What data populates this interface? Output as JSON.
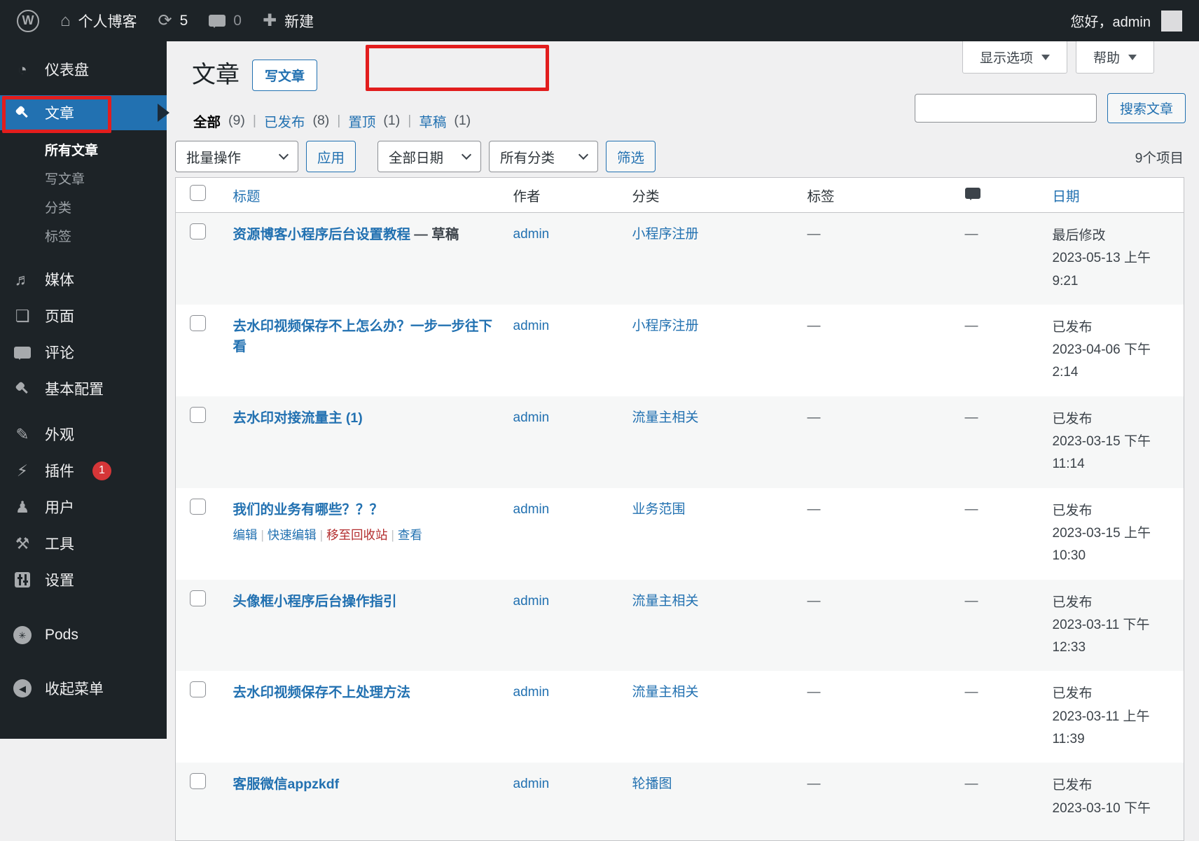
{
  "accent_colors": {
    "link_blue": "#2271b1",
    "sidebar_dark": "#1d2327",
    "annotation_red": "#e21d1d",
    "badge_red": "#d63638"
  },
  "admin_bar": {
    "site_name": "个人博客",
    "updates_count": "5",
    "comments_count": "0",
    "new_label": "新建",
    "greeting": "您好，admin"
  },
  "sidebar": {
    "items": [
      {
        "label": "仪表盘"
      },
      {
        "label": "文章"
      },
      {
        "label": "媒体"
      },
      {
        "label": "页面"
      },
      {
        "label": "评论"
      },
      {
        "label": "基本配置"
      },
      {
        "label": "外观"
      },
      {
        "label": "插件"
      },
      {
        "label": "用户"
      },
      {
        "label": "工具"
      },
      {
        "label": "设置"
      },
      {
        "label": "Pods"
      },
      {
        "label": "收起菜单"
      }
    ],
    "plugins_badge": "1",
    "submenu": [
      {
        "label": "所有文章"
      },
      {
        "label": "写文章"
      },
      {
        "label": "分类"
      },
      {
        "label": "标签"
      }
    ]
  },
  "page": {
    "title": "文章",
    "add_new_label": "写文章",
    "screen_options_label": "显示选项",
    "help_label": "帮助",
    "search_button_label": "搜索文章",
    "items_count": "9个项目",
    "filters": [
      {
        "label": "全部",
        "count": "(9)"
      },
      {
        "label": "已发布",
        "count": "(8)"
      },
      {
        "label": "置顶",
        "count": "(1)"
      },
      {
        "label": "草稿",
        "count": "(1)"
      }
    ],
    "bulk": {
      "bulk_action": "批量操作",
      "apply": "应用",
      "all_dates": "全部日期",
      "all_categories": "所有分类",
      "filter": "筛选"
    }
  },
  "table": {
    "headers": {
      "title": "标题",
      "author": "作者",
      "category": "分类",
      "tags": "标签",
      "date": "日期"
    },
    "row_actions": {
      "edit": "编辑",
      "quick_edit": "快速编辑",
      "trash": "移至回收站",
      "view": "查看"
    },
    "rows": [
      {
        "title": "资源博客小程序后台设置教程",
        "state": "— 草稿",
        "author": "admin",
        "category": "小程序注册",
        "tags": "—",
        "comments": "—",
        "status": "最后修改",
        "datetime": "2023-05-13 上午 9:21"
      },
      {
        "title": "去水印视频保存不上怎么办？一步一步往下看",
        "author": "admin",
        "category": "小程序注册",
        "tags": "—",
        "comments": "—",
        "status": "已发布",
        "datetime": "2023-04-06 下午 2:14"
      },
      {
        "title": "去水印对接流量主 (1)",
        "author": "admin",
        "category": "流量主相关",
        "tags": "—",
        "comments": "—",
        "status": "已发布",
        "datetime": "2023-03-15 下午 11:14"
      },
      {
        "title": "我们的业务有哪些？？？",
        "author": "admin",
        "category": "业务范围",
        "tags": "—",
        "comments": "—",
        "status": "已发布",
        "datetime": "2023-03-15 上午 10:30"
      },
      {
        "title": "头像框小程序后台操作指引",
        "author": "admin",
        "category": "流量主相关",
        "tags": "—",
        "comments": "—",
        "status": "已发布",
        "datetime": "2023-03-11 下午 12:33"
      },
      {
        "title": "去水印视频保存不上处理方法",
        "author": "admin",
        "category": "流量主相关",
        "tags": "—",
        "comments": "—",
        "status": "已发布",
        "datetime": "2023-03-11 上午 11:39"
      },
      {
        "title": "客服微信appzkdf",
        "author": "admin",
        "category": "轮播图",
        "tags": "—",
        "comments": "—",
        "status": "已发布",
        "datetime": "2023-03-10 下午"
      }
    ]
  }
}
